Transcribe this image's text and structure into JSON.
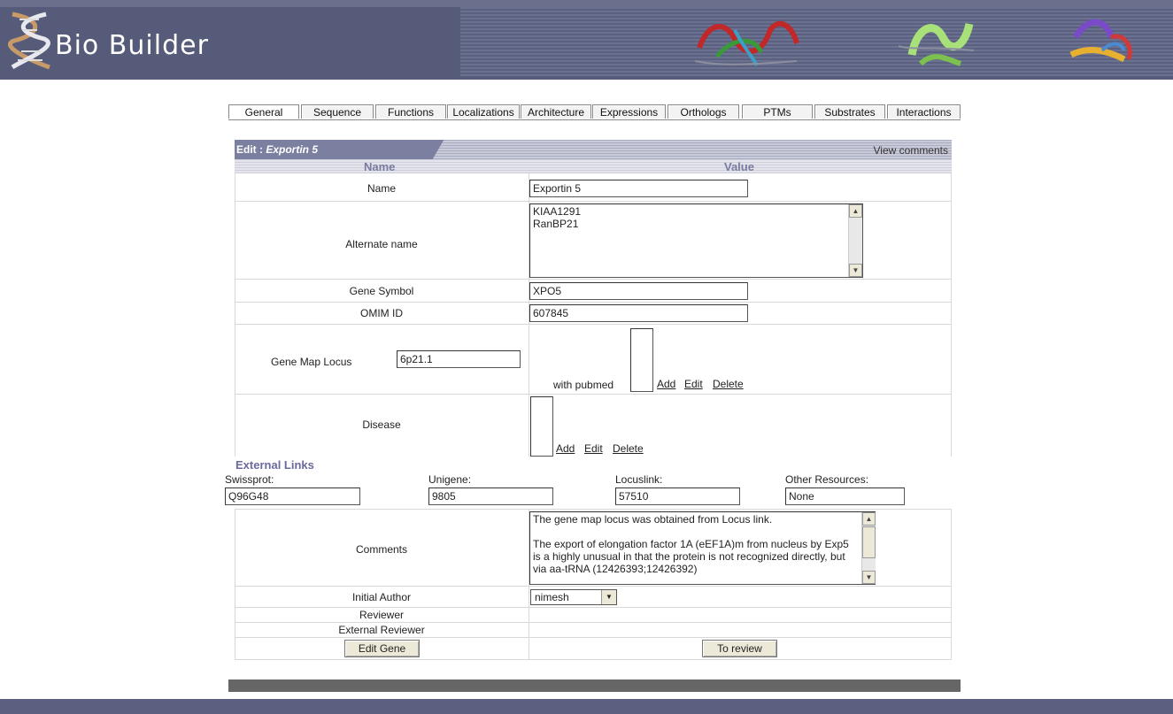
{
  "app": {
    "title": "Bio Builder"
  },
  "tabs": [
    {
      "label": "General",
      "active": true
    },
    {
      "label": "Sequence"
    },
    {
      "label": "Functions"
    },
    {
      "label": "Localizations"
    },
    {
      "label": "Architecture"
    },
    {
      "label": "Expressions"
    },
    {
      "label": "Orthologs"
    },
    {
      "label": "PTMs"
    },
    {
      "label": "Substrates"
    },
    {
      "label": "Interactions"
    }
  ],
  "edit": {
    "prefix": "Edit : ",
    "name": "Exportin 5",
    "view_comments": "View comments"
  },
  "columns": {
    "name": "Name",
    "value": "Value"
  },
  "fields": {
    "name": {
      "label": "Name",
      "value": "Exportin 5"
    },
    "alternate_name": {
      "label": "Alternate name",
      "value": "KIAA1291\nRanBP21"
    },
    "gene_symbol": {
      "label": "Gene Symbol",
      "value": "XPO5"
    },
    "omim_id": {
      "label": "OMIM ID",
      "value": "607845"
    },
    "gene_map_locus": {
      "label": "Gene Map Locus",
      "value": "6p21.1",
      "with_pubmed": "with pubmed"
    },
    "disease": {
      "label": "Disease"
    }
  },
  "actions": {
    "add": "Add",
    "edit": "Edit",
    "delete": "Delete"
  },
  "external_links": {
    "title": "External Links",
    "swissprot": {
      "label": "Swissprot:",
      "value": "Q96G48"
    },
    "unigene": {
      "label": "Unigene:",
      "value": "9805"
    },
    "locuslink": {
      "label": "Locuslink:",
      "value": "57510"
    },
    "other": {
      "label": "Other Resources:",
      "value": "None"
    }
  },
  "comments": {
    "label": "Comments",
    "value": "The gene map locus was obtained from Locus link.\n\nThe export of elongation factor 1A (eEF1A)m from nucleus by Exp5 is a highly unusual in that the protein is not recognized directly, but via aa-tRNA (12426393;12426392)"
  },
  "initial_author": {
    "label": "Initial Author",
    "selected": "nimesh"
  },
  "reviewer": {
    "label": "Reviewer"
  },
  "external_reviewer": {
    "label": "External Reviewer"
  },
  "buttons": {
    "edit_gene": "Edit Gene",
    "to_review": "To review"
  },
  "icons": {
    "logo": "dna-helix-logo",
    "proteins": "protein-structure-images"
  }
}
